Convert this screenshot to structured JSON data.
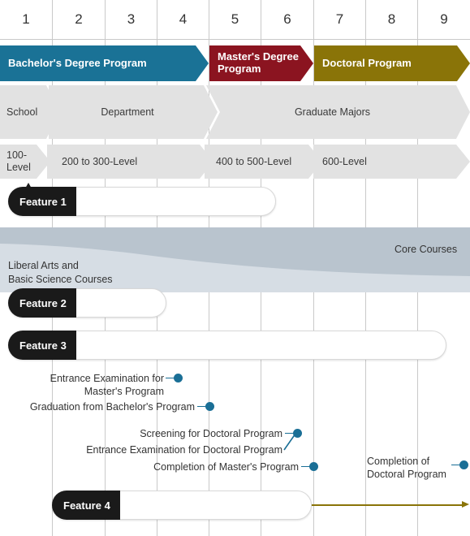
{
  "colors": {
    "bachelor": "#1a7296",
    "master": "#8b1420",
    "doctoral": "#8a7408",
    "band_core": "#b9c4ce",
    "band_liberal": "#d6dde4",
    "chevron_gray": "#e2e2e2",
    "milestone_dot": "#1a6f96",
    "pill_tab": "#1a1a1a",
    "gridline": "#c9c9c9"
  },
  "header": {
    "years": [
      "1",
      "2",
      "3",
      "4",
      "5",
      "6",
      "7",
      "8",
      "9"
    ]
  },
  "programs": [
    {
      "label": "Bachelor's Degree Program",
      "span": "1-4"
    },
    {
      "label": "Master's Degree Program",
      "span": "5-6"
    },
    {
      "label": "Doctoral Program",
      "span": "7-9"
    }
  ],
  "org_row": [
    {
      "label": "School"
    },
    {
      "label": "Department"
    },
    {
      "label": "Graduate Majors"
    }
  ],
  "level_row": [
    {
      "label": "100-Level"
    },
    {
      "label": "200 to 300-Level"
    },
    {
      "label": "400 to 500-Level"
    },
    {
      "label": "600-Level"
    }
  ],
  "course_band": {
    "core_label": "Core Courses",
    "liberal_label": "Liberal Arts and\nBasic Science Courses",
    "liberal_line1": "Liberal Arts and",
    "liberal_line2": "Basic Science Courses"
  },
  "features": [
    {
      "label": "Feature 1"
    },
    {
      "label": "Feature 2"
    },
    {
      "label": "Feature 3"
    },
    {
      "label": "Feature 4"
    }
  ],
  "milestones": [
    {
      "line1": "Entrance Examination for",
      "line2": "Master's Program"
    },
    {
      "line1": "Graduation from Bachelor's Program",
      "line2": ""
    },
    {
      "line1": "Screening for Doctoral Program",
      "line2": ""
    },
    {
      "line1": "Entrance Examination for Doctoral Program",
      "line2": ""
    },
    {
      "line1": "Completion of Master's Program",
      "line2": ""
    },
    {
      "line1": "Completion of",
      "line2": "Doctoral Program"
    }
  ]
}
